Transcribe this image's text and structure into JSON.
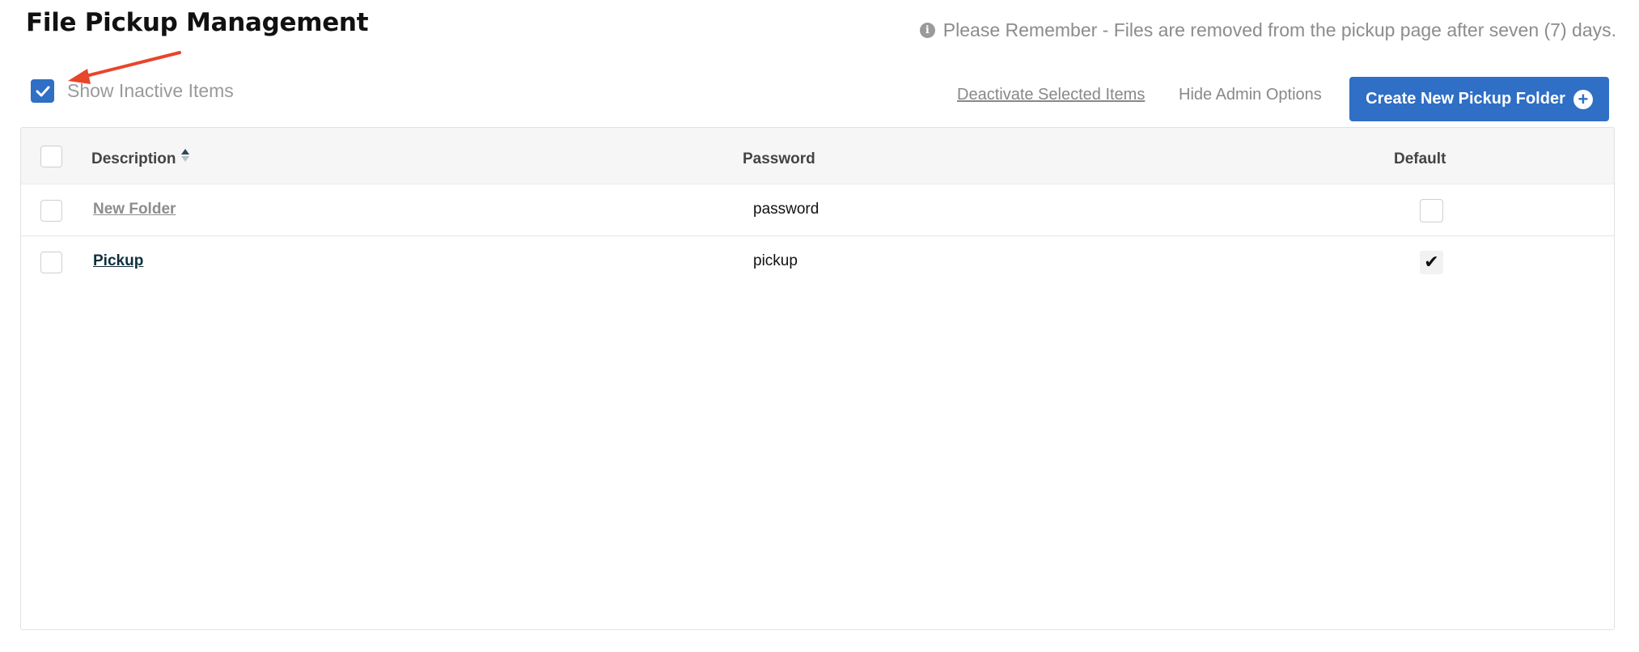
{
  "header": {
    "title": "File Pickup Management",
    "notice": "Please Remember - Files are removed from the pickup page after seven (7) days."
  },
  "toolbar": {
    "show_inactive_label": "Show Inactive Items",
    "show_inactive_checked": true,
    "deactivate_label": "Deactivate Selected Items",
    "hide_admin_label": "Hide Admin Options",
    "create_label": "Create New Pickup Folder"
  },
  "table": {
    "columns": [
      "Description",
      "Password",
      "Default"
    ],
    "rows": [
      {
        "description": "New Folder",
        "password": "password",
        "default": false,
        "inactive": true
      },
      {
        "description": "Pickup",
        "password": "pickup",
        "default": true,
        "inactive": false
      }
    ]
  },
  "colors": {
    "accent": "#2f6fc5",
    "annotation_arrow": "#e8452c",
    "inactive_text": "#8d8d8d"
  },
  "icons": [
    "info-icon",
    "check-icon",
    "sort-icon",
    "plus-circle-icon",
    "arrow-annotation"
  ]
}
